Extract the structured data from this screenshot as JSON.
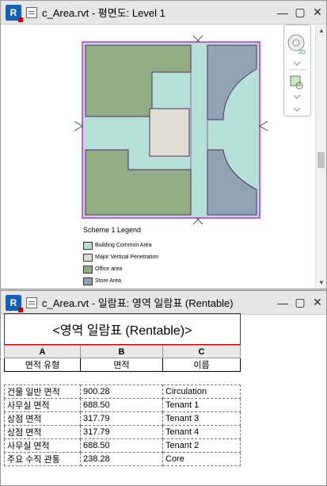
{
  "plan_window": {
    "title": "c_Area.rvt - 평면도: Level 1",
    "app_logo": "R",
    "buttons": {
      "min": "—",
      "max": "▢",
      "close": "✕"
    },
    "legend": {
      "title": "Scheme 1 Legend",
      "items": [
        {
          "label": "Building Common Area",
          "color": "#b4e0d8"
        },
        {
          "label": "Major Vertical Penetration",
          "color": "#e0ded0"
        },
        {
          "label": "Office area",
          "color": "#94ae84"
        },
        {
          "label": "Store Area",
          "color": "#8fa3b2"
        }
      ]
    }
  },
  "schedule_window": {
    "title": "c_Area.rvt - 일람표: 영역 일람표 (Rentable)",
    "app_logo": "R",
    "buttons": {
      "min": "—",
      "max": "▢",
      "close": "✕"
    },
    "schedule_title": "<영역 일람표 (Rentable)>",
    "col_letters": [
      "A",
      "B",
      "C"
    ],
    "headers": [
      "면적 유형",
      "면적",
      "이름"
    ],
    "rows": [
      [
        "건물 일반 면적",
        "900.28",
        "Circulation"
      ],
      [
        "사무실 면적",
        "688.50",
        "Tenant 1"
      ],
      [
        "상점 면적",
        "317.79",
        "Tenant 3"
      ],
      [
        "상점 면적",
        "317.79",
        "Tenant 4"
      ],
      [
        "사무실 면적",
        "688.50",
        "Tenant 2"
      ],
      [
        "주요 수직 관통",
        "238.28",
        "Core"
      ]
    ]
  }
}
